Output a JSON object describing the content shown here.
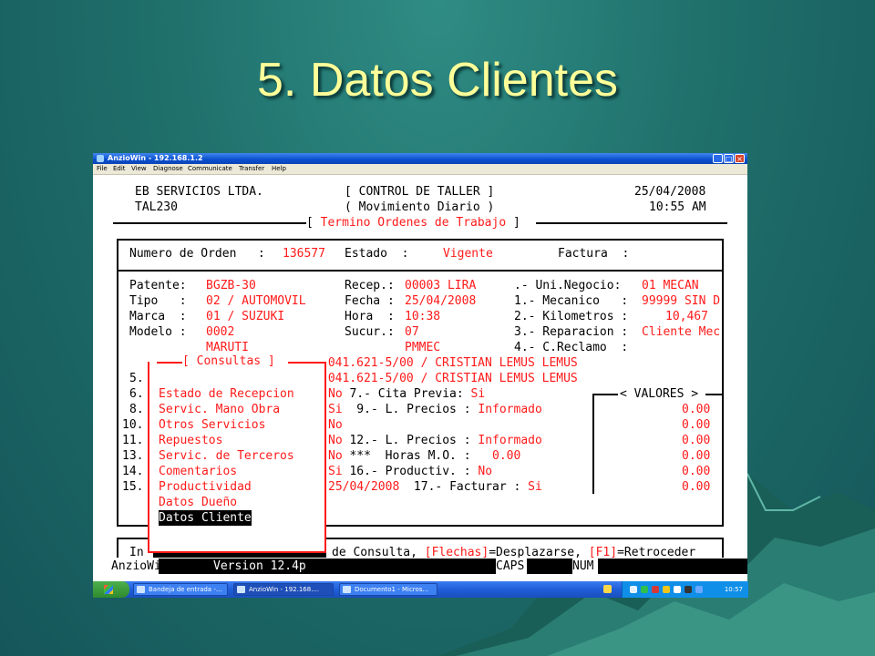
{
  "slide": {
    "title": "5. Datos Clientes"
  },
  "window": {
    "title": "AnzioWin - 192.168.1.2",
    "menu": [
      "File",
      "Edit",
      "View",
      "Diagnose",
      "Communicate",
      "Transfer",
      "Help"
    ]
  },
  "header": {
    "company": "EB SERVICIOS LTDA.",
    "program": "TAL230",
    "module": "[ CONTROL DE TALLER ]",
    "submodule": "( Movimiento Diario )",
    "date": "25/04/2008",
    "time": "10:55 AM",
    "section": "Termino Ordenes de Trabajo"
  },
  "order": {
    "numero_label": "Numero de Orden   :",
    "numero": "136577",
    "estado_label": "Estado  :",
    "estado": "Vigente",
    "factura_label": "Factura  :"
  },
  "vehicle": {
    "patente_label": "Patente:",
    "patente": "BGZB-30",
    "tipo_label": "Tipo   :",
    "tipo": "02 / AUTOMOVIL",
    "marca_label": "Marca  :",
    "marca": "01 / SUZUKI",
    "modelo_label": "Modelo :",
    "modelo": "0002",
    "modelo_desc": "MARUTI",
    "recep_label": "Recep.:",
    "recep": "00003 LIRA",
    "fecha_label": "Fecha :",
    "fecha": "25/04/2008",
    "hora_label": "Hora  :",
    "hora": "10:38",
    "sucur_label": "Sucur.:",
    "sucur": "07",
    "sucur_desc": "PMMEC",
    "uni_label": ".- Uni.Negocio:",
    "uni": "01 MECAN",
    "mecanico_label": "1.- Mecanico   :",
    "mecanico": "99999 SIN D",
    "km_label": "2.- Kilometros :",
    "km": "10,467",
    "reparacion_label": "3.- Reparacion :",
    "reparacion": "Cliente Mec",
    "reclamo_label": "4.- C.Reclamo  :"
  },
  "left_numbers": [
    "5.",
    "6.",
    "8.",
    "10.",
    "11.",
    "13.",
    "14.",
    "15."
  ],
  "right_fields": [
    {
      "value": ".041.621-5/00 / CRISTIAN LEMUS LEMUS",
      "label": ""
    },
    {
      "value": ".041.621-5/00 / CRISTIAN LEMUS LEMUS",
      "label": ""
    },
    {
      "value": "No",
      "label": " 7.- Cita Previa: ",
      "value2": "Si"
    },
    {
      "value": "Si",
      "label": "  9.- L. Precios : ",
      "value2": "Informado"
    },
    {
      "value": "No",
      "label": "",
      "value2": ""
    },
    {
      "value": "No",
      "label": " 12.- L. Precios : ",
      "value2": "Informado"
    },
    {
      "value": "No",
      "label": " ***  Horas M.O. :  ",
      "value2": " 0.00"
    },
    {
      "value": "Si",
      "label": " 16.- Productiv. : ",
      "value2": "No"
    },
    {
      "value": "25/04/2008",
      "label": "  17.- Facturar : ",
      "value2": "Si"
    }
  ],
  "valores": {
    "title": "< VALORES >",
    "amounts": [
      "0.00",
      "0.00",
      "0.00",
      "0.00",
      "0.00",
      "0.00"
    ]
  },
  "consultas": {
    "title": "[ Consultas ]",
    "items": [
      "Estado de Recepcion",
      "Servic. Mano Obra",
      "Otros Servicios",
      "Repuestos",
      "Servic. de Terceros",
      "Comentarios",
      "Productividad",
      "Datos Dueño",
      "Datos Cliente"
    ],
    "selected": "Datos Cliente"
  },
  "help_line": {
    "prefix": "In",
    "text": "de Consulta, ",
    "flechas": "[Flechas]",
    "mid": "=Desplazarse, ",
    "f1": "[F1]",
    "end": "=Retroceder"
  },
  "status_bar": {
    "app": "AnzioWin",
    "version": "Version 12.4p",
    "caps": "CAPS",
    "num": "NUM"
  },
  "taskbar": {
    "tasks": [
      "Bandeja de entrada -...",
      "AnzioWin - 192.168....",
      "Documento1 - Micros..."
    ],
    "clock": "10:57"
  }
}
